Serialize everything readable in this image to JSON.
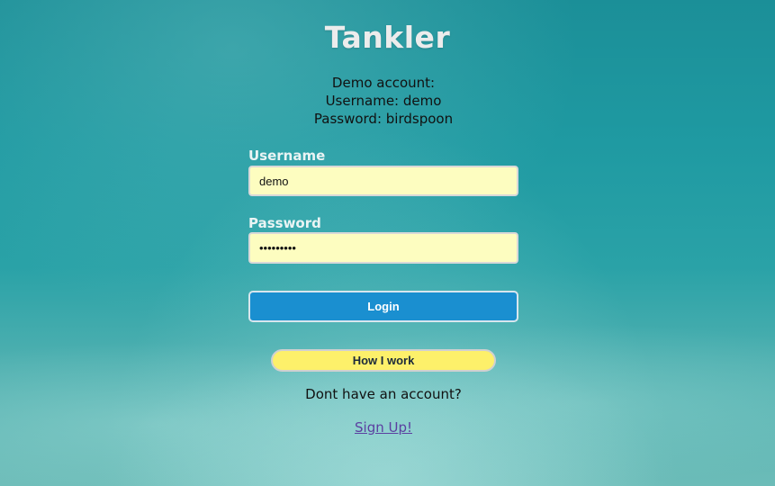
{
  "app": {
    "title": "Tankler"
  },
  "demo": {
    "line1": "Demo account:",
    "line2": "Username: demo",
    "line3": "Password: birdspoon"
  },
  "form": {
    "username_label": "Username",
    "username_value": "demo",
    "password_label": "Password",
    "password_value": "birdspoon",
    "login_label": "Login"
  },
  "extras": {
    "how_label": "How I work",
    "no_account_text": "Dont have an account?",
    "signup_label": "Sign Up!"
  },
  "colors": {
    "login_button": "#1a8fd0",
    "how_button": "#fdf06a",
    "input_background": "#fdfdc0",
    "link": "#5b3fa0"
  }
}
